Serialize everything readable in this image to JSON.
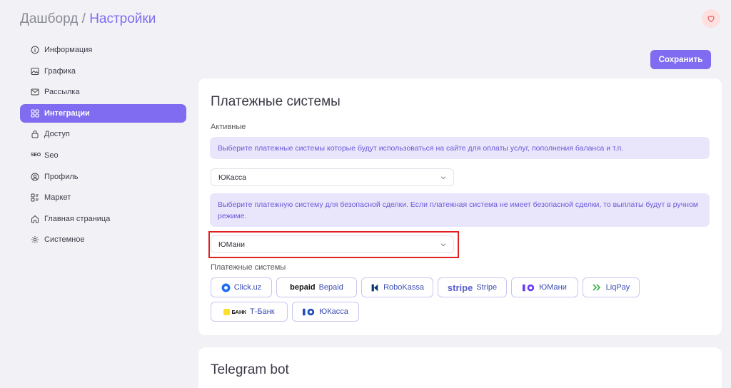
{
  "breadcrumb": {
    "root": "Дашборд",
    "sep": " / ",
    "current": "Настройки"
  },
  "toolbar": {
    "save_label": "Сохранить"
  },
  "sidebar": {
    "items": [
      {
        "label": "Информация",
        "icon": "info-icon"
      },
      {
        "label": "Графика",
        "icon": "image-icon"
      },
      {
        "label": "Рассылка",
        "icon": "mail-icon"
      },
      {
        "label": "Интеграции",
        "icon": "grid-icon",
        "active": true
      },
      {
        "label": "Доступ",
        "icon": "lock-icon"
      },
      {
        "label": "Seo",
        "icon": "seo-icon",
        "icon_text": "SEO"
      },
      {
        "label": "Профиль",
        "icon": "user-circle-icon"
      },
      {
        "label": "Маркет",
        "icon": "market-icon"
      },
      {
        "label": "Главная страница",
        "icon": "home-icon"
      },
      {
        "label": "Системное",
        "icon": "gear-icon"
      }
    ]
  },
  "payments": {
    "title": "Платежные системы",
    "active_label": "Активные",
    "info_active": "Выберите платежные системы которые будут использоваться на сайте для оплаты услуг, пополнения баланса и т.п.",
    "active_select": "ЮКасса",
    "info_safe_deal": "Выберите платежную систему для безопасной сделки. Если платежная система не имеет безопасной сделки, то выплаты будут в ручном режиме.",
    "safe_deal_select": "ЮМани",
    "systems_label": "Платежные системы",
    "systems": [
      {
        "name": "Click.uz",
        "icon": "clickuz-logo-icon"
      },
      {
        "name": "Bepaid",
        "icon": "bepaid-logo-icon",
        "logo_text": "bepaid"
      },
      {
        "name": "RoboKassa",
        "icon": "robokassa-logo-icon"
      },
      {
        "name": "Stripe",
        "icon": "stripe-logo-icon",
        "logo_text": "stripe"
      },
      {
        "name": "ЮМани",
        "icon": "yoomoney-logo-icon"
      },
      {
        "name": "LiqPay",
        "icon": "liqpay-logo-icon"
      },
      {
        "name": "Т-Банк",
        "icon": "tbank-logo-icon",
        "logo_text": "БАНК"
      },
      {
        "name": "ЮКасса",
        "icon": "yookassa-logo-icon"
      }
    ]
  },
  "telegram": {
    "title": "Telegram bot"
  },
  "colors": {
    "accent": "#7f6cf0",
    "info_bg": "#e9e6fc",
    "highlight": "#e02020"
  }
}
